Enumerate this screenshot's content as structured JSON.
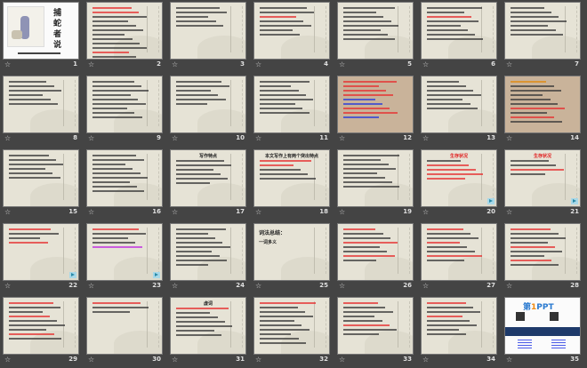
{
  "view": "slide-sorter",
  "slides": [
    {
      "number": "1",
      "theme": "white",
      "title_vertical": "捕蛇者说"
    },
    {
      "number": "2",
      "theme": "beige"
    },
    {
      "number": "3",
      "theme": "beige"
    },
    {
      "number": "4",
      "theme": "beige"
    },
    {
      "number": "5",
      "theme": "beige"
    },
    {
      "number": "6",
      "theme": "beige"
    },
    {
      "number": "7",
      "theme": "beige"
    },
    {
      "number": "8",
      "theme": "beige"
    },
    {
      "number": "9",
      "theme": "beige"
    },
    {
      "number": "10",
      "theme": "beige"
    },
    {
      "number": "11",
      "theme": "beige"
    },
    {
      "number": "12",
      "theme": "brown"
    },
    {
      "number": "13",
      "theme": "beige"
    },
    {
      "number": "14",
      "theme": "brown"
    },
    {
      "number": "15",
      "theme": "beige"
    },
    {
      "number": "16",
      "theme": "beige"
    },
    {
      "number": "17",
      "theme": "beige",
      "title": "写作特点"
    },
    {
      "number": "18",
      "theme": "beige",
      "title": "本文写作上有两个突出特点"
    },
    {
      "number": "19",
      "theme": "beige"
    },
    {
      "number": "20",
      "theme": "beige",
      "title_red": "生存状况"
    },
    {
      "number": "21",
      "theme": "beige",
      "title_red": "生存状况"
    },
    {
      "number": "22",
      "theme": "beige"
    },
    {
      "number": "23",
      "theme": "beige"
    },
    {
      "number": "24",
      "theme": "beige"
    },
    {
      "number": "25",
      "theme": "beige",
      "title": "词法总结：",
      "subtitle": "一词多义"
    },
    {
      "number": "26",
      "theme": "beige"
    },
    {
      "number": "27",
      "theme": "beige"
    },
    {
      "number": "28",
      "theme": "beige"
    },
    {
      "number": "29",
      "theme": "beige"
    },
    {
      "number": "30",
      "theme": "beige"
    },
    {
      "number": "31",
      "theme": "beige",
      "title": "虚词"
    },
    {
      "number": "32",
      "theme": "beige"
    },
    {
      "number": "33",
      "theme": "beige"
    },
    {
      "number": "34",
      "theme": "beige"
    },
    {
      "number": "35",
      "theme": "white",
      "logo_main": "第",
      "logo_num": "1",
      "logo_tail": "PPT"
    }
  ],
  "icons": {
    "slide_star": "star-outline-icon",
    "play": "play-icon"
  }
}
